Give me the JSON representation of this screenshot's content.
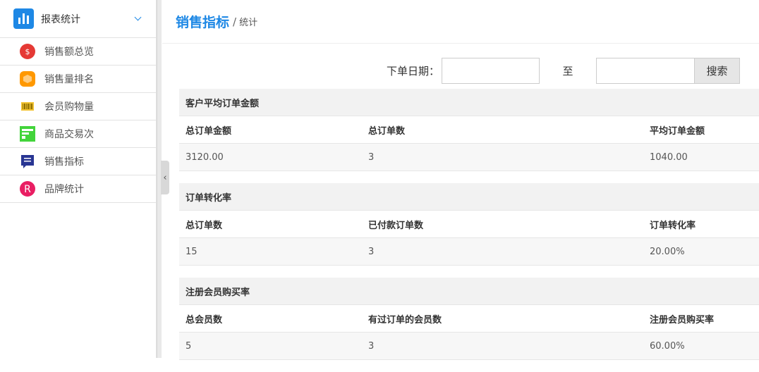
{
  "sidebar": {
    "title": "报表统计",
    "items": [
      {
        "label": "销售额总览",
        "icon": "money-bag-icon",
        "color": "#e53935"
      },
      {
        "label": "销售量排名",
        "icon": "box-icon",
        "color": "#ff9800"
      },
      {
        "label": "会员购物量",
        "icon": "barcode-icon",
        "color": "#f2c230"
      },
      {
        "label": "商品交易次",
        "icon": "form-icon",
        "color": "#43d43b"
      },
      {
        "label": "销售指标",
        "icon": "message-icon",
        "color": "#283593"
      },
      {
        "label": "品牌统计",
        "icon": "registered-icon",
        "color": "#e91e63"
      }
    ]
  },
  "header": {
    "title": "销售指标",
    "separator": "/",
    "subtitle": "统计"
  },
  "search": {
    "date_label": "下单日期：",
    "to_label": "至",
    "button_label": "搜索",
    "start_value": "",
    "end_value": ""
  },
  "blocks": [
    {
      "title": "客户平均订单金额",
      "headers": [
        "总订单金额",
        "总订单数",
        "平均订单金额"
      ],
      "values": [
        "3120.00",
        "3",
        "1040.00"
      ]
    },
    {
      "title": "订单转化率",
      "headers": [
        "总订单数",
        "已付款订单数",
        "订单转化率"
      ],
      "values": [
        "15",
        "3",
        "20.00%"
      ]
    },
    {
      "title": "注册会员购买率",
      "headers": [
        "总会员数",
        "有过订单的会员数",
        "注册会员购买率"
      ],
      "values": [
        "5",
        "3",
        "60.00%"
      ]
    }
  ],
  "colors": {
    "accent": "#1e88e5"
  }
}
